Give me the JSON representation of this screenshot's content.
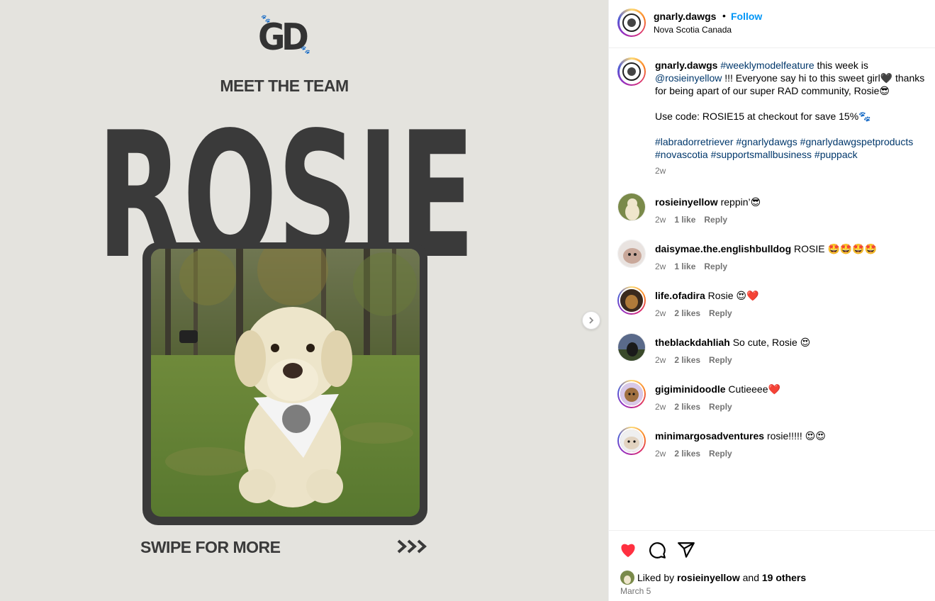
{
  "media": {
    "logo_text": "GD",
    "meet_title": "MEET THE TEAM",
    "name_big": "ROSIE",
    "swipe_text": "SWIPE FOR MORE",
    "arrows_text": ">>>",
    "colors": {
      "background": "#e4e3de",
      "ink": "#3a3a3a"
    }
  },
  "header": {
    "username": "gnarly.dawgs",
    "dot": "•",
    "follow_label": "Follow",
    "location": "Nova Scotia Canada"
  },
  "caption": {
    "username": "gnarly.dawgs",
    "hashtag_feature": "#weeklymodelfeature",
    "text1": " this week is",
    "mention": "@rosieinyellow",
    "text2": " !!! Everyone say hi to this sweet girl🖤 thanks for being apart of our super RAD community, Rosie😎",
    "code_line": "Use code: ROSIE15 at checkout for save 15%🐾",
    "hashtags_line1": "#labradorretriever #gnarlydawgs #gnarlydawgspetproducts",
    "hashtags_line2": "#novascotia #supportsmallbusiness #puppack",
    "time": "2w"
  },
  "comments": [
    {
      "username": "rosieinyellow",
      "text": " reppin’😎",
      "time": "2w",
      "likes": "1 like",
      "reply": "Reply"
    },
    {
      "username": "daisymae.the.englishbulldog",
      "text": " ROSIE 🤩🤩🤩🤩",
      "time": "2w",
      "likes": "1 like",
      "reply": "Reply"
    },
    {
      "username": "life.ofadira",
      "text": " Rosie 😍❤️",
      "time": "2w",
      "likes": "2 likes",
      "reply": "Reply"
    },
    {
      "username": "theblackdahliah",
      "text": " So cute, Rosie 😍",
      "time": "2w",
      "likes": "2 likes",
      "reply": "Reply"
    },
    {
      "username": "gigiminidoodle",
      "text": " Cutieeee❤️",
      "time": "2w",
      "likes": "2 likes",
      "reply": "Reply"
    },
    {
      "username": "minimargosadventures",
      "text": " rosie!!!!! 😍😍",
      "time": "2w",
      "likes": "2 likes",
      "reply": "Reply"
    }
  ],
  "footer": {
    "liked_prefix": "Liked by ",
    "liked_user": "rosieinyellow",
    "liked_mid": " and ",
    "liked_others": "19 others",
    "date": "March 5",
    "like_color": "#ff3040"
  },
  "icons": [
    "heart-icon",
    "comment-icon",
    "share-icon",
    "chevron-right-icon"
  ]
}
